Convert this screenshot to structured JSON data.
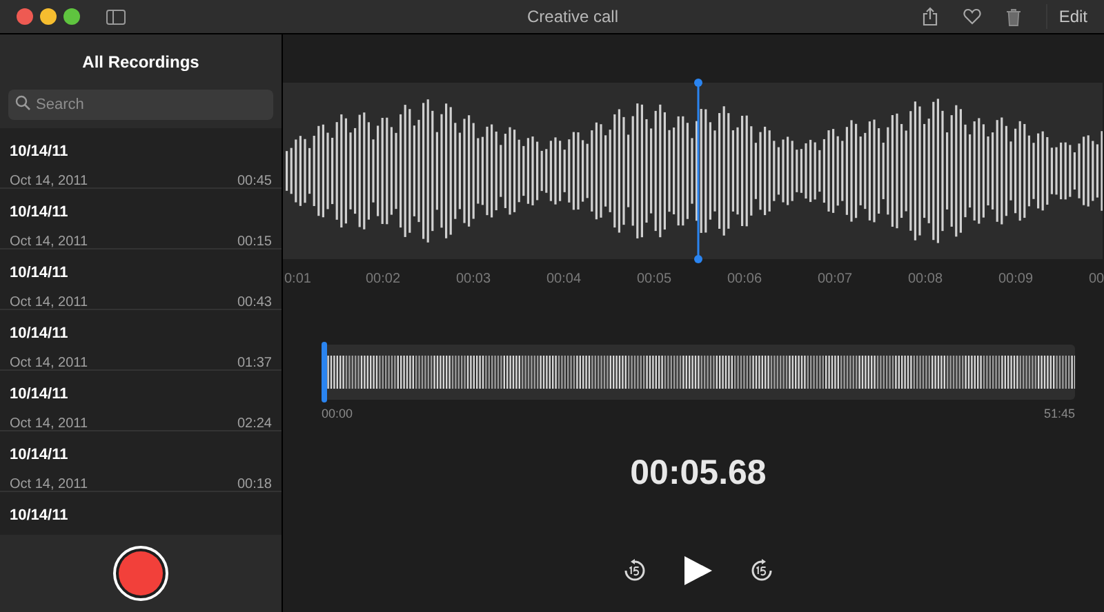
{
  "window": {
    "title": "Creative call",
    "edit_button": "Edit"
  },
  "sidebar": {
    "title": "All Recordings",
    "search": {
      "placeholder": "Search"
    },
    "recordings": [
      {
        "title": "10/14/11",
        "date": "Oct 14, 2011",
        "duration": "00:45"
      },
      {
        "title": "10/14/11",
        "date": "Oct 14, 2011",
        "duration": "00:15"
      },
      {
        "title": "10/14/11",
        "date": "Oct 14, 2011",
        "duration": "00:43"
      },
      {
        "title": "10/14/11",
        "date": "Oct 14, 2011",
        "duration": "01:37"
      },
      {
        "title": "10/14/11",
        "date": "Oct 14, 2011",
        "duration": "02:24"
      },
      {
        "title": "10/14/11",
        "date": "Oct 14, 2011",
        "duration": "00:18"
      },
      {
        "title": "10/14/11"
      }
    ]
  },
  "timeline": {
    "ticks": [
      "0:01",
      "00:02",
      "00:03",
      "00:04",
      "00:05",
      "00:06",
      "00:07",
      "00:08",
      "00:09",
      "00"
    ]
  },
  "overview": {
    "start": "00:00",
    "end": "51:45"
  },
  "current_time": "00:05.68"
}
